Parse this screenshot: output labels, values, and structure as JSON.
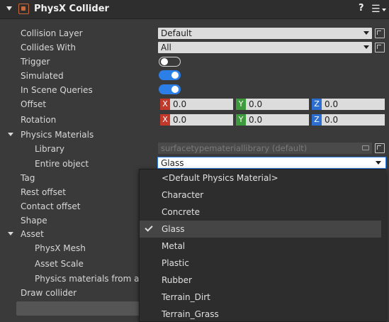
{
  "component": {
    "title": "PhysX Collider",
    "help_label": "?",
    "menu_label": "☰"
  },
  "properties": {
    "collision_layer": {
      "label": "Collision Layer",
      "value": "Default"
    },
    "collides_with": {
      "label": "Collides With",
      "value": "All"
    },
    "trigger": {
      "label": "Trigger",
      "checked": false
    },
    "simulated": {
      "label": "Simulated",
      "checked": true
    },
    "in_scene_queries": {
      "label": "In Scene Queries",
      "checked": true
    },
    "offset": {
      "label": "Offset",
      "x_axis": "X",
      "y_axis": "Y",
      "z_axis": "Z",
      "x": "0.0",
      "y": "0.0",
      "z": "0.0"
    },
    "rotation": {
      "label": "Rotation",
      "x_axis": "X",
      "y_axis": "Y",
      "z_axis": "Z",
      "x": "0.0",
      "y": "0.0",
      "z": "0.0"
    },
    "physics_materials": {
      "label": "Physics Materials",
      "library": {
        "label": "Library",
        "value": "surfacetypemateriallibrary (default)"
      },
      "entire_object": {
        "label": "Entire object",
        "value": "Glass"
      }
    },
    "tag": {
      "label": "Tag"
    },
    "rest_offset": {
      "label": "Rest offset"
    },
    "contact_offset": {
      "label": "Contact offset"
    },
    "shape": {
      "label": "Shape"
    },
    "asset": {
      "label": "Asset",
      "physx_mesh": {
        "label": "PhysX Mesh"
      },
      "asset_scale": {
        "label": "Asset Scale"
      },
      "physics_materials_from_asset": {
        "label": "Physics materials from ass"
      }
    },
    "draw_collider": {
      "label": "Draw collider"
    }
  },
  "dropdown": {
    "options": [
      "<Default Physics Material>",
      "Character",
      "Concrete",
      "Glass",
      "Metal",
      "Plastic",
      "Rubber",
      "Terrain_Dirt",
      "Terrain_Grass"
    ],
    "selected": "Glass"
  },
  "colors": {
    "accent": "#2d7fe8",
    "axis_x": "#c0392b",
    "axis_y": "#3d9a3d",
    "axis_z": "#2d6fd0"
  }
}
